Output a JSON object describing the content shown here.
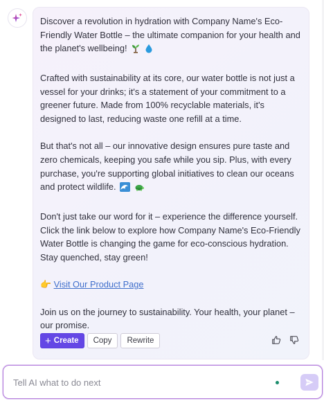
{
  "message": {
    "paragraphs": [
      "Discover a revolution in hydration with Company Name's Eco-Friendly Water Bottle – the ultimate companion for your health and the planet's wellbeing!",
      "Crafted with sustainability at its core, our water bottle is not just a vessel for your drinks; it's a statement of your commitment to a greener future. Made from 100% recyclable materials, it's designed to last, reducing waste one refill at a time.",
      "But that's not all – our innovative design ensures pure taste and zero chemicals, keeping you safe while you sip. Plus, with every purchase, you're supporting global initiatives to clean our oceans and protect wildlife.",
      "Don't just take our word for it – experience the difference yourself. Click the link below to explore how Company Name's Eco-Friendly Water Bottle is changing the game for eco-conscious hydration. Stay quenched, stay green!"
    ],
    "link_prefix_emoji": "👉",
    "link_text": "Visit Our Product Page",
    "closing": "Join us on the journey to sustainability. Your health, your planet – our promise."
  },
  "actions": {
    "create": "Create",
    "copy": "Copy",
    "rewrite": "Rewrite"
  },
  "composer": {
    "placeholder": "Tell AI what to do next"
  },
  "icons": {
    "assistant": "sparkle-icon",
    "thumbs_up": "thumbs-up-icon",
    "thumbs_down": "thumbs-down-icon",
    "send": "send-icon"
  },
  "colors": {
    "accent": "#6447e5",
    "link": "#3f6ecb",
    "composer_border": "#b47bdc",
    "send_button": "#d6ccf7"
  }
}
